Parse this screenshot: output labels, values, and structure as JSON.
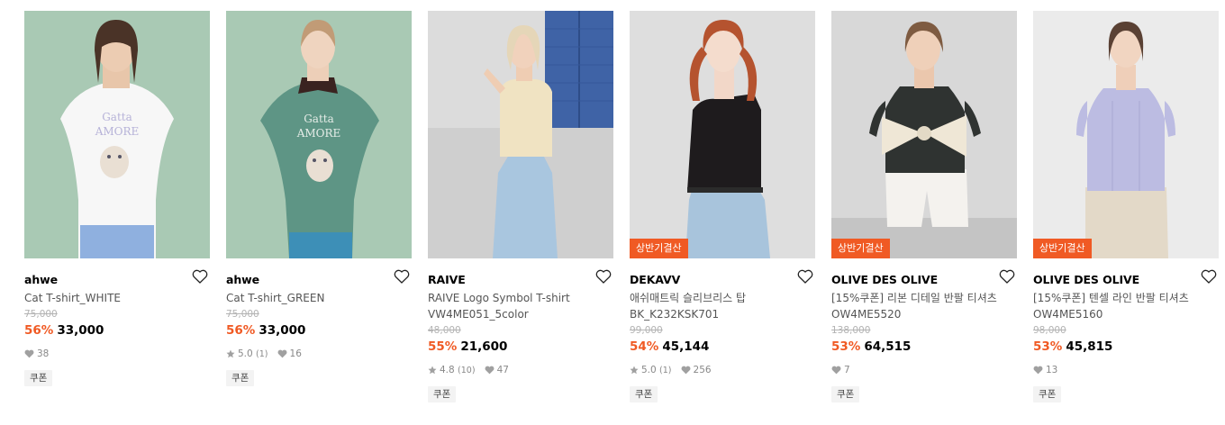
{
  "products": [
    {
      "brand": "ahwe",
      "name_line1": "Cat T-shirt_WHITE",
      "name_line2": "",
      "original_price": "75,000",
      "discount": "56%",
      "price": "33,000",
      "rating": "",
      "reviews": "",
      "likes": "38",
      "sale_tag": "",
      "coupon": "쿠폰",
      "bg_color": "#a7c8b3"
    },
    {
      "brand": "ahwe",
      "name_line1": "Cat T-shirt_GREEN",
      "name_line2": "",
      "original_price": "75,000",
      "discount": "56%",
      "price": "33,000",
      "rating": "5.0",
      "reviews": "(1)",
      "likes": "16",
      "sale_tag": "",
      "coupon": "쿠폰",
      "bg_color": "#a7c8b3"
    },
    {
      "brand": "RAIVE",
      "name_line1": "RAIVE Logo Symbol T-shirt",
      "name_line2": "VW4ME051_5color",
      "original_price": "48,000",
      "discount": "55%",
      "price": "21,600",
      "rating": "4.8",
      "reviews": "(10)",
      "likes": "47",
      "sale_tag": "",
      "coupon": "쿠폰",
      "bg_color": "#dadada"
    },
    {
      "brand": "DEKAVV",
      "name_line1": "애쉬매트릭 슬리브리스 탑",
      "name_line2": "BK_K232KSK701",
      "original_price": "99,000",
      "discount": "54%",
      "price": "45,144",
      "rating": "5.0",
      "reviews": "(1)",
      "likes": "256",
      "sale_tag": "상반기결산",
      "coupon": "쿠폰",
      "bg_color": "#dcdcdc"
    },
    {
      "brand": "OLIVE DES OLIVE",
      "name_line1": "[15%쿠폰] 리본 디테일 반팔 티셔츠",
      "name_line2": "OW4ME5520",
      "original_price": "138,000",
      "discount": "53%",
      "price": "64,515",
      "rating": "",
      "reviews": "",
      "likes": "7",
      "sale_tag": "상반기결산",
      "coupon": "쿠폰",
      "bg_color": "#d5d5d5"
    },
    {
      "brand": "OLIVE DES OLIVE",
      "name_line1": "[15%쿠폰] 텐셀 라인 반팔 티셔츠",
      "name_line2": "OW4ME5160",
      "original_price": "98,000",
      "discount": "53%",
      "price": "45,815",
      "rating": "",
      "reviews": "",
      "likes": "13",
      "sale_tag": "상반기결산",
      "coupon": "쿠폰",
      "bg_color": "#e8e8e8"
    }
  ],
  "colors": {
    "accent": "#f05a24",
    "strike": "#b3b3b3",
    "muted": "#888888"
  }
}
